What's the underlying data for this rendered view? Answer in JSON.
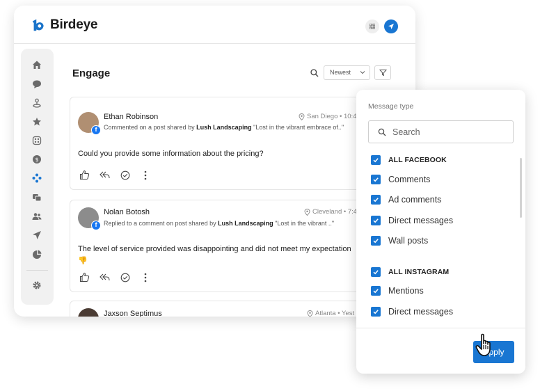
{
  "app": {
    "brand": "Birdeye"
  },
  "colors": {
    "accent": "#1976d2",
    "facebook": "#1877f2"
  },
  "sidebar": {
    "items": [
      {
        "icon": "home-icon"
      },
      {
        "icon": "chat-bubble-icon"
      },
      {
        "icon": "listings-icon"
      },
      {
        "icon": "star-icon"
      },
      {
        "icon": "ticketing-icon"
      },
      {
        "icon": "payments-icon"
      },
      {
        "icon": "engage-icon"
      },
      {
        "icon": "messages-icon"
      },
      {
        "icon": "people-icon"
      },
      {
        "icon": "campaigns-send-icon"
      },
      {
        "icon": "reports-pie-icon"
      },
      {
        "icon": "gear-icon"
      }
    ]
  },
  "main": {
    "title": "Engage",
    "sort": {
      "selected": "Newest"
    }
  },
  "posts": [
    {
      "author": "Ethan Robinson",
      "location": "San Diego • 10:4",
      "sub_prefix": "Commented on a post shared by",
      "sub_business": "Lush Landscaping",
      "sub_quote": "\"Lost in the vibrant embrace of..\"",
      "message": "Could you provide some information about the pricing?"
    },
    {
      "author": "Nolan Botosh",
      "location": "Cleveland • 7:4",
      "sub_prefix": "Replied to a comment on post shared by",
      "sub_business": "Lush Landscaping",
      "sub_quote": "\"Lost in the vibrant ..\"",
      "message": "The level of service provided was disappointing and did not meet my expectation",
      "emoji": "👎"
    },
    {
      "author": "Jaxson Septimus",
      "location": "Atlanta • Yest"
    }
  ],
  "filter_panel": {
    "title": "Message type",
    "search_placeholder": "Search",
    "facebook_group": "ALL FACEBOOK",
    "facebook_options": [
      "Comments",
      "Ad comments",
      "Direct messages",
      "Wall posts"
    ],
    "instagram_group": "ALL INSTAGRAM",
    "instagram_options": [
      "Mentions",
      "Direct messages"
    ],
    "apply_label": "Apply"
  }
}
